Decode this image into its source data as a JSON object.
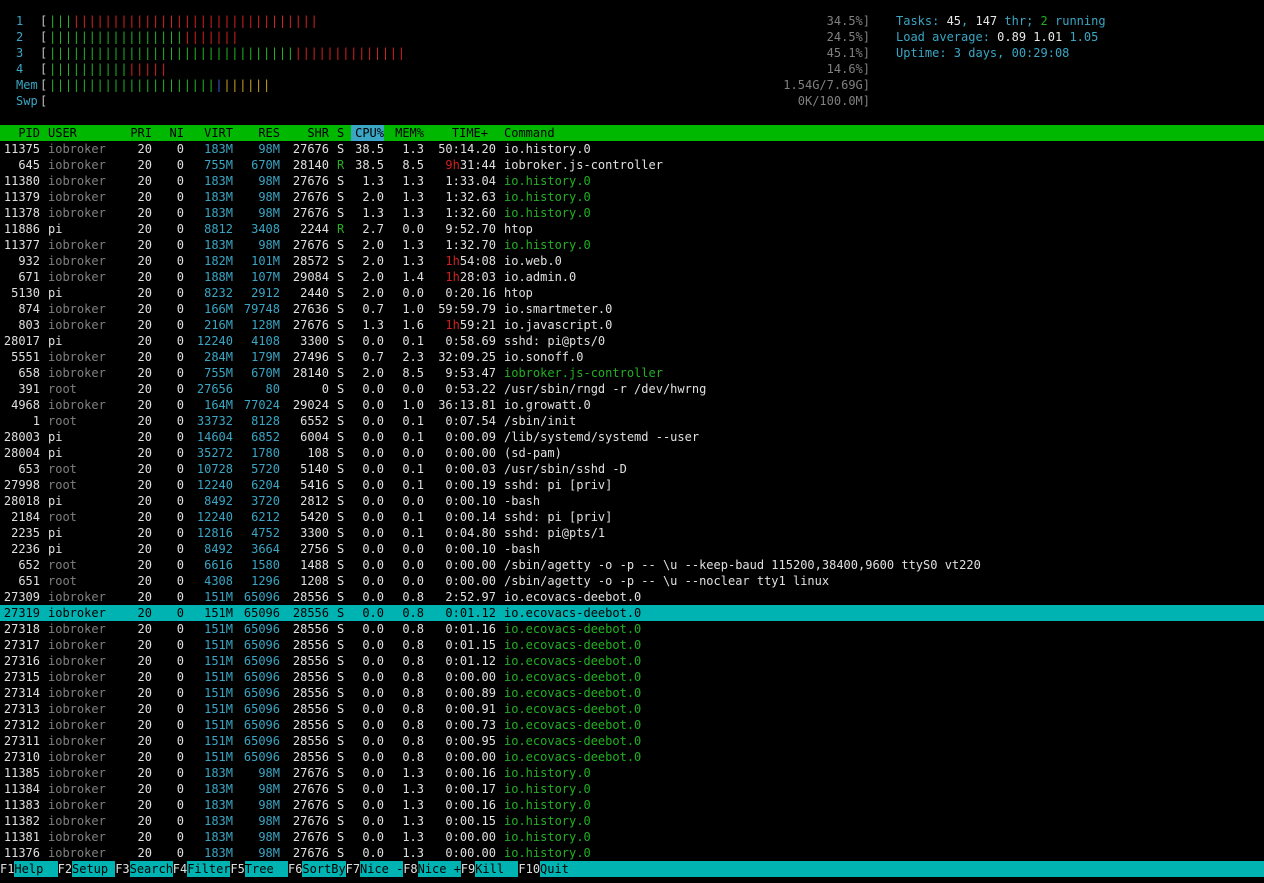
{
  "meters": [
    {
      "label": "1",
      "value": "34.5%]",
      "segments": [
        {
          "c": "g",
          "n": 3
        },
        {
          "c": "r",
          "n": 31
        }
      ]
    },
    {
      "label": "2",
      "value": "24.5%]",
      "segments": [
        {
          "c": "g",
          "n": 17
        },
        {
          "c": "r",
          "n": 7
        }
      ]
    },
    {
      "label": "3",
      "value": "45.1%]",
      "segments": [
        {
          "c": "g",
          "n": 31
        },
        {
          "c": "r",
          "n": 14
        }
      ]
    },
    {
      "label": "4",
      "value": "14.6%]",
      "segments": [
        {
          "c": "g",
          "n": 10
        },
        {
          "c": "r",
          "n": 5
        }
      ]
    },
    {
      "label": "Mem",
      "value": "1.54G/7.69G]",
      "segments": [
        {
          "c": "g",
          "n": 21
        },
        {
          "c": "b",
          "n": 1
        },
        {
          "c": "y",
          "n": 6
        }
      ]
    },
    {
      "label": "Swp",
      "value": "0K/100.0M]",
      "segments": []
    }
  ],
  "summary": {
    "tasks_label": "Tasks: ",
    "tasks": "45",
    "threads_sep": ", ",
    "threads": "147",
    "threads_label": " thr; ",
    "running": "2",
    "running_label": " running",
    "load_label": "Load average: ",
    "load1": "0.89",
    "load5": "1.01",
    "load15": "1.05",
    "uptime_label": "Uptime: ",
    "uptime": "3 days, 00:29:08"
  },
  "columns": {
    "pid": "PID",
    "user": "USER",
    "pri": "PRI",
    "ni": "NI",
    "virt": "VIRT",
    "res": "RES",
    "shr": "SHR",
    "s": "S",
    "cpu": "CPU%",
    "mem": "MEM%",
    "time": "TIME+",
    "command": "Command"
  },
  "processes": [
    {
      "pid": "11375",
      "user": "iobroker",
      "pri": "20",
      "ni": "0",
      "virt": "183M",
      "res": "98M",
      "shr": "27676",
      "s": "S",
      "cpu": "38.5",
      "mem": "1.3",
      "time": "50:14.20",
      "command": "io.history.0",
      "thread": false
    },
    {
      "pid": "645",
      "user": "iobroker",
      "pri": "20",
      "ni": "0",
      "virt": "755M",
      "res": "670M",
      "shr": "28140",
      "s": "R",
      "cpu": "38.5",
      "mem": "8.5",
      "time": "9h31:44",
      "command": "iobroker.js-controller",
      "thread": false
    },
    {
      "pid": "11380",
      "user": "iobroker",
      "pri": "20",
      "ni": "0",
      "virt": "183M",
      "res": "98M",
      "shr": "27676",
      "s": "S",
      "cpu": "1.3",
      "mem": "1.3",
      "time": "1:33.04",
      "command": "io.history.0",
      "thread": true
    },
    {
      "pid": "11379",
      "user": "iobroker",
      "pri": "20",
      "ni": "0",
      "virt": "183M",
      "res": "98M",
      "shr": "27676",
      "s": "S",
      "cpu": "2.0",
      "mem": "1.3",
      "time": "1:32.63",
      "command": "io.history.0",
      "thread": true
    },
    {
      "pid": "11378",
      "user": "iobroker",
      "pri": "20",
      "ni": "0",
      "virt": "183M",
      "res": "98M",
      "shr": "27676",
      "s": "S",
      "cpu": "1.3",
      "mem": "1.3",
      "time": "1:32.60",
      "command": "io.history.0",
      "thread": true
    },
    {
      "pid": "11886",
      "user": "pi",
      "pri": "20",
      "ni": "0",
      "virt": "8812",
      "res": "3408",
      "shr": "2244",
      "s": "R",
      "cpu": "2.7",
      "mem": "0.0",
      "time": "9:52.70",
      "command": "htop",
      "thread": false
    },
    {
      "pid": "11377",
      "user": "iobroker",
      "pri": "20",
      "ni": "0",
      "virt": "183M",
      "res": "98M",
      "shr": "27676",
      "s": "S",
      "cpu": "2.0",
      "mem": "1.3",
      "time": "1:32.70",
      "command": "io.history.0",
      "thread": true
    },
    {
      "pid": "932",
      "user": "iobroker",
      "pri": "20",
      "ni": "0",
      "virt": "182M",
      "res": "101M",
      "shr": "28572",
      "s": "S",
      "cpu": "2.0",
      "mem": "1.3",
      "time": "1h54:08",
      "command": "io.web.0",
      "thread": false
    },
    {
      "pid": "671",
      "user": "iobroker",
      "pri": "20",
      "ni": "0",
      "virt": "188M",
      "res": "107M",
      "shr": "29084",
      "s": "S",
      "cpu": "2.0",
      "mem": "1.4",
      "time": "1h28:03",
      "command": "io.admin.0",
      "thread": false
    },
    {
      "pid": "5130",
      "user": "pi",
      "pri": "20",
      "ni": "0",
      "virt": "8232",
      "res": "2912",
      "shr": "2440",
      "s": "S",
      "cpu": "2.0",
      "mem": "0.0",
      "time": "0:20.16",
      "command": "htop",
      "thread": false
    },
    {
      "pid": "874",
      "user": "iobroker",
      "pri": "20",
      "ni": "0",
      "virt": "166M",
      "res": "79748",
      "shr": "27636",
      "s": "S",
      "cpu": "0.7",
      "mem": "1.0",
      "time": "59:59.79",
      "command": "io.smartmeter.0",
      "thread": false
    },
    {
      "pid": "803",
      "user": "iobroker",
      "pri": "20",
      "ni": "0",
      "virt": "216M",
      "res": "128M",
      "shr": "27676",
      "s": "S",
      "cpu": "1.3",
      "mem": "1.6",
      "time": "1h59:21",
      "command": "io.javascript.0",
      "thread": false
    },
    {
      "pid": "28017",
      "user": "pi",
      "pri": "20",
      "ni": "0",
      "virt": "12240",
      "res": "4108",
      "shr": "3300",
      "s": "S",
      "cpu": "0.0",
      "mem": "0.1",
      "time": "0:58.69",
      "command": "sshd: pi@pts/0",
      "thread": false
    },
    {
      "pid": "5551",
      "user": "iobroker",
      "pri": "20",
      "ni": "0",
      "virt": "284M",
      "res": "179M",
      "shr": "27496",
      "s": "S",
      "cpu": "0.7",
      "mem": "2.3",
      "time": "32:09.25",
      "command": "io.sonoff.0",
      "thread": false
    },
    {
      "pid": "658",
      "user": "iobroker",
      "pri": "20",
      "ni": "0",
      "virt": "755M",
      "res": "670M",
      "shr": "28140",
      "s": "S",
      "cpu": "2.0",
      "mem": "8.5",
      "time": "9:53.47",
      "command": "iobroker.js-controller",
      "thread": true
    },
    {
      "pid": "391",
      "user": "root",
      "pri": "20",
      "ni": "0",
      "virt": "27656",
      "res": "80",
      "shr": "0",
      "s": "S",
      "cpu": "0.0",
      "mem": "0.0",
      "time": "0:53.22",
      "command": "/usr/sbin/rngd -r /dev/hwrng",
      "thread": false
    },
    {
      "pid": "4968",
      "user": "iobroker",
      "pri": "20",
      "ni": "0",
      "virt": "164M",
      "res": "77024",
      "shr": "29024",
      "s": "S",
      "cpu": "0.0",
      "mem": "1.0",
      "time": "36:13.81",
      "command": "io.growatt.0",
      "thread": false
    },
    {
      "pid": "1",
      "user": "root",
      "pri": "20",
      "ni": "0",
      "virt": "33732",
      "res": "8128",
      "shr": "6552",
      "s": "S",
      "cpu": "0.0",
      "mem": "0.1",
      "time": "0:07.54",
      "command": "/sbin/init",
      "thread": false
    },
    {
      "pid": "28003",
      "user": "pi",
      "pri": "20",
      "ni": "0",
      "virt": "14604",
      "res": "6852",
      "shr": "6004",
      "s": "S",
      "cpu": "0.0",
      "mem": "0.1",
      "time": "0:00.09",
      "command": "/lib/systemd/systemd --user",
      "thread": false
    },
    {
      "pid": "28004",
      "user": "pi",
      "pri": "20",
      "ni": "0",
      "virt": "35272",
      "res": "1780",
      "shr": "108",
      "s": "S",
      "cpu": "0.0",
      "mem": "0.0",
      "time": "0:00.00",
      "command": "(sd-pam)",
      "thread": false
    },
    {
      "pid": "653",
      "user": "root",
      "pri": "20",
      "ni": "0",
      "virt": "10728",
      "res": "5720",
      "shr": "5140",
      "s": "S",
      "cpu": "0.0",
      "mem": "0.1",
      "time": "0:00.03",
      "command": "/usr/sbin/sshd -D",
      "thread": false
    },
    {
      "pid": "27998",
      "user": "root",
      "pri": "20",
      "ni": "0",
      "virt": "12240",
      "res": "6204",
      "shr": "5416",
      "s": "S",
      "cpu": "0.0",
      "mem": "0.1",
      "time": "0:00.19",
      "command": "sshd: pi [priv]",
      "thread": false
    },
    {
      "pid": "28018",
      "user": "pi",
      "pri": "20",
      "ni": "0",
      "virt": "8492",
      "res": "3720",
      "shr": "2812",
      "s": "S",
      "cpu": "0.0",
      "mem": "0.0",
      "time": "0:00.10",
      "command": "-bash",
      "thread": false
    },
    {
      "pid": "2184",
      "user": "root",
      "pri": "20",
      "ni": "0",
      "virt": "12240",
      "res": "6212",
      "shr": "5420",
      "s": "S",
      "cpu": "0.0",
      "mem": "0.1",
      "time": "0:00.14",
      "command": "sshd: pi [priv]",
      "thread": false
    },
    {
      "pid": "2235",
      "user": "pi",
      "pri": "20",
      "ni": "0",
      "virt": "12816",
      "res": "4752",
      "shr": "3300",
      "s": "S",
      "cpu": "0.0",
      "mem": "0.1",
      "time": "0:04.80",
      "command": "sshd: pi@pts/1",
      "thread": false
    },
    {
      "pid": "2236",
      "user": "pi",
      "pri": "20",
      "ni": "0",
      "virt": "8492",
      "res": "3664",
      "shr": "2756",
      "s": "S",
      "cpu": "0.0",
      "mem": "0.0",
      "time": "0:00.10",
      "command": "-bash",
      "thread": false
    },
    {
      "pid": "652",
      "user": "root",
      "pri": "20",
      "ni": "0",
      "virt": "6616",
      "res": "1580",
      "shr": "1488",
      "s": "S",
      "cpu": "0.0",
      "mem": "0.0",
      "time": "0:00.00",
      "command": "/sbin/agetty -o -p -- \\u --keep-baud 115200,38400,9600 ttyS0 vt220",
      "thread": false
    },
    {
      "pid": "651",
      "user": "root",
      "pri": "20",
      "ni": "0",
      "virt": "4308",
      "res": "1296",
      "shr": "1208",
      "s": "S",
      "cpu": "0.0",
      "mem": "0.0",
      "time": "0:00.00",
      "command": "/sbin/agetty -o -p -- \\u --noclear tty1 linux",
      "thread": false
    },
    {
      "pid": "27309",
      "user": "iobroker",
      "pri": "20",
      "ni": "0",
      "virt": "151M",
      "res": "65096",
      "shr": "28556",
      "s": "S",
      "cpu": "0.0",
      "mem": "0.8",
      "time": "2:52.97",
      "command": "io.ecovacs-deebot.0",
      "thread": false
    },
    {
      "pid": "27319",
      "user": "iobroker",
      "pri": "20",
      "ni": "0",
      "virt": "151M",
      "res": "65096",
      "shr": "28556",
      "s": "S",
      "cpu": "0.0",
      "mem": "0.8",
      "time": "0:01.12",
      "command": "io.ecovacs-deebot.0",
      "thread": true,
      "selected": true
    },
    {
      "pid": "27318",
      "user": "iobroker",
      "pri": "20",
      "ni": "0",
      "virt": "151M",
      "res": "65096",
      "shr": "28556",
      "s": "S",
      "cpu": "0.0",
      "mem": "0.8",
      "time": "0:01.16",
      "command": "io.ecovacs-deebot.0",
      "thread": true
    },
    {
      "pid": "27317",
      "user": "iobroker",
      "pri": "20",
      "ni": "0",
      "virt": "151M",
      "res": "65096",
      "shr": "28556",
      "s": "S",
      "cpu": "0.0",
      "mem": "0.8",
      "time": "0:01.15",
      "command": "io.ecovacs-deebot.0",
      "thread": true
    },
    {
      "pid": "27316",
      "user": "iobroker",
      "pri": "20",
      "ni": "0",
      "virt": "151M",
      "res": "65096",
      "shr": "28556",
      "s": "S",
      "cpu": "0.0",
      "mem": "0.8",
      "time": "0:01.12",
      "command": "io.ecovacs-deebot.0",
      "thread": true
    },
    {
      "pid": "27315",
      "user": "iobroker",
      "pri": "20",
      "ni": "0",
      "virt": "151M",
      "res": "65096",
      "shr": "28556",
      "s": "S",
      "cpu": "0.0",
      "mem": "0.8",
      "time": "0:00.00",
      "command": "io.ecovacs-deebot.0",
      "thread": true
    },
    {
      "pid": "27314",
      "user": "iobroker",
      "pri": "20",
      "ni": "0",
      "virt": "151M",
      "res": "65096",
      "shr": "28556",
      "s": "S",
      "cpu": "0.0",
      "mem": "0.8",
      "time": "0:00.89",
      "command": "io.ecovacs-deebot.0",
      "thread": true
    },
    {
      "pid": "27313",
      "user": "iobroker",
      "pri": "20",
      "ni": "0",
      "virt": "151M",
      "res": "65096",
      "shr": "28556",
      "s": "S",
      "cpu": "0.0",
      "mem": "0.8",
      "time": "0:00.91",
      "command": "io.ecovacs-deebot.0",
      "thread": true
    },
    {
      "pid": "27312",
      "user": "iobroker",
      "pri": "20",
      "ni": "0",
      "virt": "151M",
      "res": "65096",
      "shr": "28556",
      "s": "S",
      "cpu": "0.0",
      "mem": "0.8",
      "time": "0:00.73",
      "command": "io.ecovacs-deebot.0",
      "thread": true
    },
    {
      "pid": "27311",
      "user": "iobroker",
      "pri": "20",
      "ni": "0",
      "virt": "151M",
      "res": "65096",
      "shr": "28556",
      "s": "S",
      "cpu": "0.0",
      "mem": "0.8",
      "time": "0:00.95",
      "command": "io.ecovacs-deebot.0",
      "thread": true
    },
    {
      "pid": "27310",
      "user": "iobroker",
      "pri": "20",
      "ni": "0",
      "virt": "151M",
      "res": "65096",
      "shr": "28556",
      "s": "S",
      "cpu": "0.0",
      "mem": "0.8",
      "time": "0:00.00",
      "command": "io.ecovacs-deebot.0",
      "thread": true
    },
    {
      "pid": "11385",
      "user": "iobroker",
      "pri": "20",
      "ni": "0",
      "virt": "183M",
      "res": "98M",
      "shr": "27676",
      "s": "S",
      "cpu": "0.0",
      "mem": "1.3",
      "time": "0:00.16",
      "command": "io.history.0",
      "thread": true
    },
    {
      "pid": "11384",
      "user": "iobroker",
      "pri": "20",
      "ni": "0",
      "virt": "183M",
      "res": "98M",
      "shr": "27676",
      "s": "S",
      "cpu": "0.0",
      "mem": "1.3",
      "time": "0:00.17",
      "command": "io.history.0",
      "thread": true
    },
    {
      "pid": "11383",
      "user": "iobroker",
      "pri": "20",
      "ni": "0",
      "virt": "183M",
      "res": "98M",
      "shr": "27676",
      "s": "S",
      "cpu": "0.0",
      "mem": "1.3",
      "time": "0:00.16",
      "command": "io.history.0",
      "thread": true
    },
    {
      "pid": "11382",
      "user": "iobroker",
      "pri": "20",
      "ni": "0",
      "virt": "183M",
      "res": "98M",
      "shr": "27676",
      "s": "S",
      "cpu": "0.0",
      "mem": "1.3",
      "time": "0:00.15",
      "command": "io.history.0",
      "thread": true
    },
    {
      "pid": "11381",
      "user": "iobroker",
      "pri": "20",
      "ni": "0",
      "virt": "183M",
      "res": "98M",
      "shr": "27676",
      "s": "S",
      "cpu": "0.0",
      "mem": "1.3",
      "time": "0:00.00",
      "command": "io.history.0",
      "thread": true
    },
    {
      "pid": "11376",
      "user": "iobroker",
      "pri": "20",
      "ni": "0",
      "virt": "183M",
      "res": "98M",
      "shr": "27676",
      "s": "S",
      "cpu": "0.0",
      "mem": "1.3",
      "time": "0:00.00",
      "command": "io.history.0",
      "thread": true
    }
  ],
  "footer": [
    {
      "key": "F1",
      "label": "Help  "
    },
    {
      "key": "F2",
      "label": "Setup "
    },
    {
      "key": "F3",
      "label": "Search"
    },
    {
      "key": "F4",
      "label": "Filter"
    },
    {
      "key": "F5",
      "label": "Tree  "
    },
    {
      "key": "F6",
      "label": "SortBy"
    },
    {
      "key": "F7",
      "label": "Nice -"
    },
    {
      "key": "F8",
      "label": "Nice +"
    },
    {
      "key": "F9",
      "label": "Kill  "
    },
    {
      "key": "F10",
      "label": "Quit"
    }
  ],
  "colors": {
    "header_bg": "#00b800",
    "selected_bg": "#00b3b3",
    "thread_fg": "#22b022",
    "cyan": "#3aa6c4"
  }
}
